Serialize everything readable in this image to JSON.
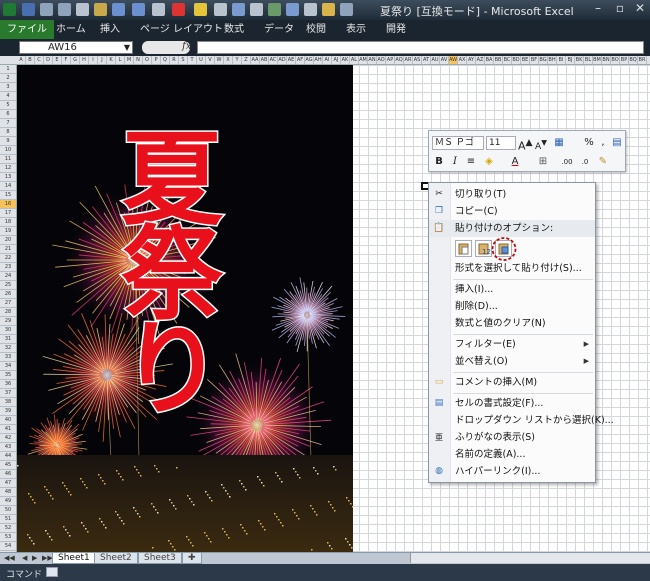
{
  "window": {
    "title": "夏祭り [互換モード] - Microsoft Excel",
    "controls": [
      "minimize",
      "restore",
      "close"
    ]
  },
  "ribbon": {
    "tabs": [
      "ファイル",
      "ホーム",
      "挿入",
      "ページ レイアウト",
      "数式",
      "データ",
      "校閲",
      "表示",
      "開発"
    ]
  },
  "formula_bar": {
    "name_box": "AW16",
    "fx_label": "fx",
    "value": ""
  },
  "grid": {
    "selected_column": "AW",
    "selected_row": "16"
  },
  "picture": {
    "text": [
      "夏",
      "祭",
      "り"
    ],
    "text_color": "#e8101a",
    "background": "#050509"
  },
  "mini_toolbar": {
    "font_name": "ＭＳ Ｐゴ",
    "font_size": "11",
    "row1": [
      "increase-font-size",
      "decrease-font-size",
      "number-format",
      "percent",
      "comma",
      "format-painter"
    ],
    "row2": [
      "B",
      "I",
      "center",
      "fill-color",
      "A",
      "borders",
      "increase-decimal",
      "decrease-decimal",
      "clear"
    ]
  },
  "context_menu": {
    "cut": "切り取り(T)",
    "copy": "コピー(C)",
    "paste_options": "貼り付けのオプション:",
    "paste_special": "形式を選択して貼り付け(S)...",
    "insert": "挿入(I)...",
    "delete": "削除(D)...",
    "clear": "数式と値のクリア(N)",
    "filter": "フィルター(E)",
    "sort": "並べ替え(O)",
    "insert_comment": "コメントの挿入(M)",
    "format_cells": "セルの書式設定(F)...",
    "dropdown": "ドロップダウン リストから選択(K)...",
    "furigana": "ふりがなの表示(S)",
    "define_name": "名前の定義(A)...",
    "hyperlink": "ハイパーリンク(I)...",
    "highlight_color": "#d40000"
  },
  "sheets": {
    "tabs": [
      "Sheet1",
      "Sheet2",
      "Sheet3"
    ],
    "active": "Sheet1"
  },
  "status_bar": {
    "mode": "コマンド"
  }
}
